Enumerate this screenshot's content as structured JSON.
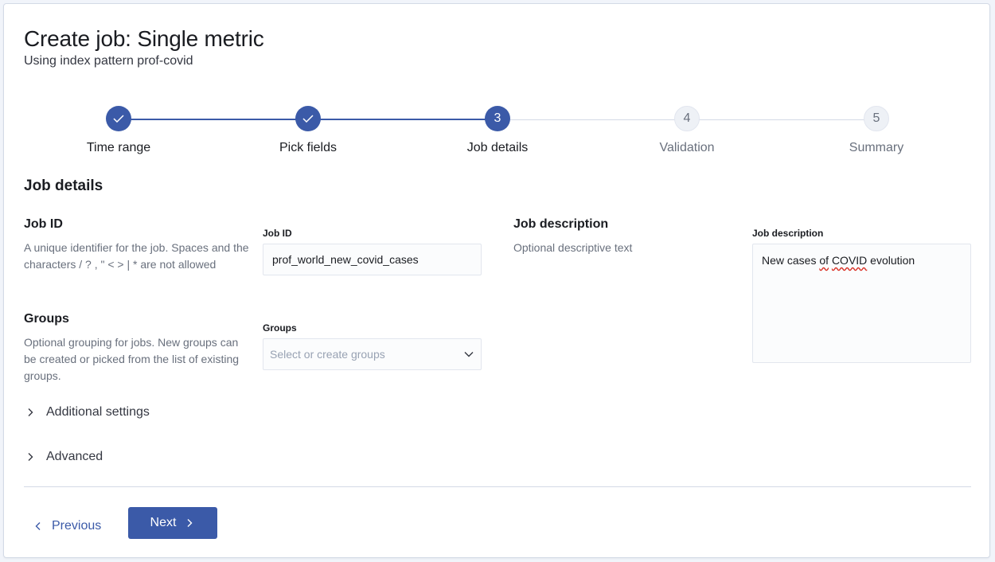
{
  "header": {
    "title": "Create job: Single metric",
    "subtitle": "Using index pattern prof-covid"
  },
  "stepper": {
    "steps": [
      {
        "label": "Time range",
        "status": "complete",
        "number": "1"
      },
      {
        "label": "Pick fields",
        "status": "complete",
        "number": "2"
      },
      {
        "label": "Job details",
        "status": "current",
        "number": "3"
      },
      {
        "label": "Validation",
        "status": "incomplete",
        "number": "4"
      },
      {
        "label": "Summary",
        "status": "incomplete",
        "number": "5"
      }
    ]
  },
  "section": {
    "title": "Job details"
  },
  "job_id": {
    "title": "Job ID",
    "description": "A unique identifier for the job. Spaces and the characters / ? , \" < > | * are not allowed",
    "label": "Job ID",
    "value": "prof_world_new_covid_cases"
  },
  "groups": {
    "title": "Groups",
    "description": "Optional grouping for jobs. New groups can be created or picked from the list of existing groups.",
    "label": "Groups",
    "placeholder": "Select or create groups"
  },
  "job_description": {
    "title": "Job description",
    "description": "Optional descriptive text",
    "label": "Job description",
    "value_before": "New cases ",
    "value_of": "of",
    "value_space": " ",
    "value_covid": "COVID",
    "value_after": " evolution"
  },
  "accordions": {
    "additional": "Additional settings",
    "advanced": "Advanced"
  },
  "footer": {
    "previous_label": "Previous",
    "next_label": "Next"
  },
  "colors": {
    "primary": "#3b5aa8",
    "text": "#1a1c21",
    "subdued": "#69707d",
    "border": "#d3dae6"
  }
}
